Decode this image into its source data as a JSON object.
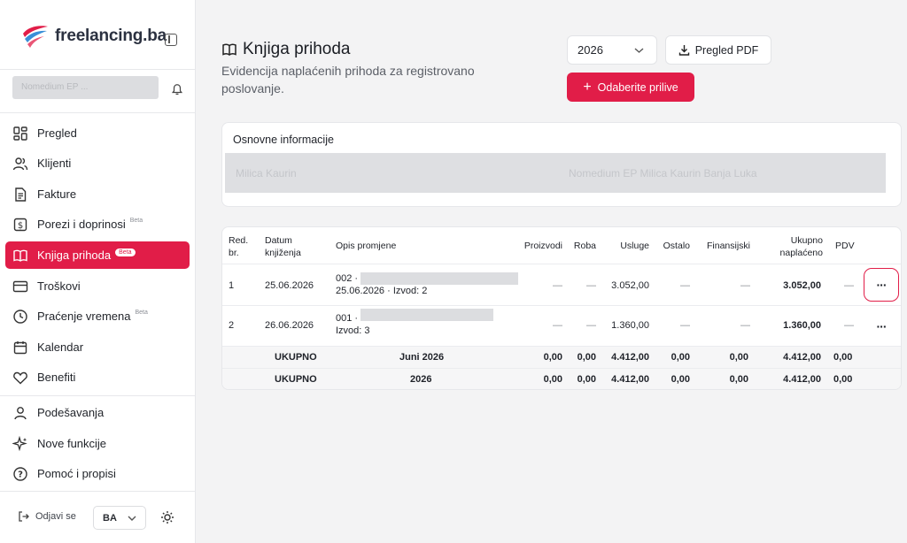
{
  "brand": {
    "name": "freelancing.ba"
  },
  "user": {
    "name": "Nomedium EP ..."
  },
  "sidebar": {
    "items": [
      {
        "label": "Pregled",
        "beta": ""
      },
      {
        "label": "Klijenti",
        "beta": ""
      },
      {
        "label": "Fakture",
        "beta": ""
      },
      {
        "label": "Porezi i doprinosi",
        "beta": "Beta"
      },
      {
        "label": "Knjiga prihoda",
        "beta": "Beta",
        "active": true
      },
      {
        "label": "Troškovi",
        "beta": ""
      },
      {
        "label": "Praćenje vremena",
        "beta": "Beta"
      },
      {
        "label": "Kalendar",
        "beta": ""
      },
      {
        "label": "Benefiti",
        "beta": ""
      },
      {
        "label": "Podešavanja",
        "beta": ""
      },
      {
        "label": "Nove funkcije",
        "beta": ""
      },
      {
        "label": "Pomoć i propisi",
        "beta": ""
      }
    ],
    "logout_label": "Odjavi se",
    "language": "BA"
  },
  "header": {
    "title": "Knjiga prihoda",
    "subtitle": "Evidencija naplaćenih prihoda za registrovano poslovanje.",
    "year": "2026",
    "pdf_label": "Pregled PDF",
    "add_label": "Odaberite prilive"
  },
  "info": {
    "title": "Osnovne informacije",
    "left_text": "Milica Kaurin",
    "right_text": "Nomedium EP Milica Kaurin Banja Luka"
  },
  "table": {
    "columns": {
      "rb": "Red. br.",
      "date": "Datum knjiženja",
      "desc": "Opis promjene",
      "proizvodi": "Proizvodi",
      "roba": "Roba",
      "usluge": "Usluge",
      "ostalo": "Ostalo",
      "finansijski": "Finansijski",
      "ukupno": "Ukupno naplaćeno",
      "pdv": "PDV"
    },
    "rows": [
      {
        "rb": "1",
        "date": "25.06.2026",
        "desc_line1": "002 ·",
        "desc_line2": "25.06.2026 · Izvod: 2",
        "proizvodi": "—",
        "roba": "—",
        "usluge": "3.052,00",
        "ostalo": "—",
        "finansijski": "—",
        "ukupno": "3.052,00",
        "pdv": "—"
      },
      {
        "rb": "2",
        "date": "26.06.2026",
        "desc_line1": "001 ·",
        "desc_line2": "Izvod: 3",
        "proizvodi": "—",
        "roba": "—",
        "usluge": "1.360,00",
        "ostalo": "—",
        "finansijski": "—",
        "ukupno": "1.360,00",
        "pdv": "—"
      }
    ],
    "totals": [
      {
        "label": "UKUPNO",
        "period": "Juni 2026",
        "proizvodi": "0,00",
        "roba": "0,00",
        "usluge": "4.412,00",
        "ostalo": "0,00",
        "finansijski": "0,00",
        "ukupno": "4.412,00",
        "pdv": "0,00"
      },
      {
        "label": "UKUPNO",
        "period": "2026",
        "proizvodi": "0,00",
        "roba": "0,00",
        "usluge": "4.412,00",
        "ostalo": "0,00",
        "finansijski": "0,00",
        "ukupno": "4.412,00",
        "pdv": "0,00"
      }
    ]
  },
  "colors": {
    "accent": "#e11d48",
    "background": "#f3f3f4"
  }
}
